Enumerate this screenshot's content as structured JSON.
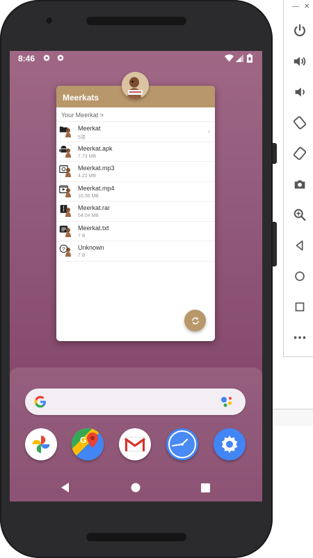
{
  "status_bar": {
    "time": "8:46"
  },
  "app": {
    "title": "Meerkats",
    "breadcrumb": "Your Meerkat >",
    "files": [
      {
        "name": "Meerkat",
        "size": "5项",
        "type": "folder-icon",
        "has_chevron": true
      },
      {
        "name": "Meerkat.apk",
        "size": "7.73 MB",
        "type": "android-icon"
      },
      {
        "name": "Meerkat.mp3",
        "size": "4.22 MB",
        "type": "audio-icon"
      },
      {
        "name": "Meerkat.mp4",
        "size": "16.06 MB",
        "type": "video-icon"
      },
      {
        "name": "Meerkat.rar",
        "size": "54.04 MB",
        "type": "archive-icon"
      },
      {
        "name": "Meerkat.txt",
        "size": "7 B",
        "type": "text-file-icon"
      },
      {
        "name": "Unknown",
        "size": "7 B",
        "type": "unknown-file-icon"
      }
    ],
    "fab_icon": "refresh-icon"
  },
  "colors": {
    "accent": "#b8976a",
    "wallpaper_top": "#a06785",
    "wallpaper_bottom": "#7c3c60"
  },
  "dock": {
    "search_logo": "google-logo",
    "search_mic": "google-assistant-icon",
    "apps": [
      {
        "name": "photos-app-icon"
      },
      {
        "name": "maps-app-icon"
      },
      {
        "name": "gmail-app-icon"
      },
      {
        "name": "clock-app-icon"
      },
      {
        "name": "settings-app-icon"
      }
    ]
  },
  "emulator_toolbar": {
    "buttons": [
      "power-icon",
      "volume-up-icon",
      "volume-down-icon",
      "rotate-left-icon",
      "rotate-right-icon",
      "camera-icon",
      "zoom-icon",
      "back-icon",
      "home-icon",
      "overview-icon",
      "more-icon"
    ]
  }
}
